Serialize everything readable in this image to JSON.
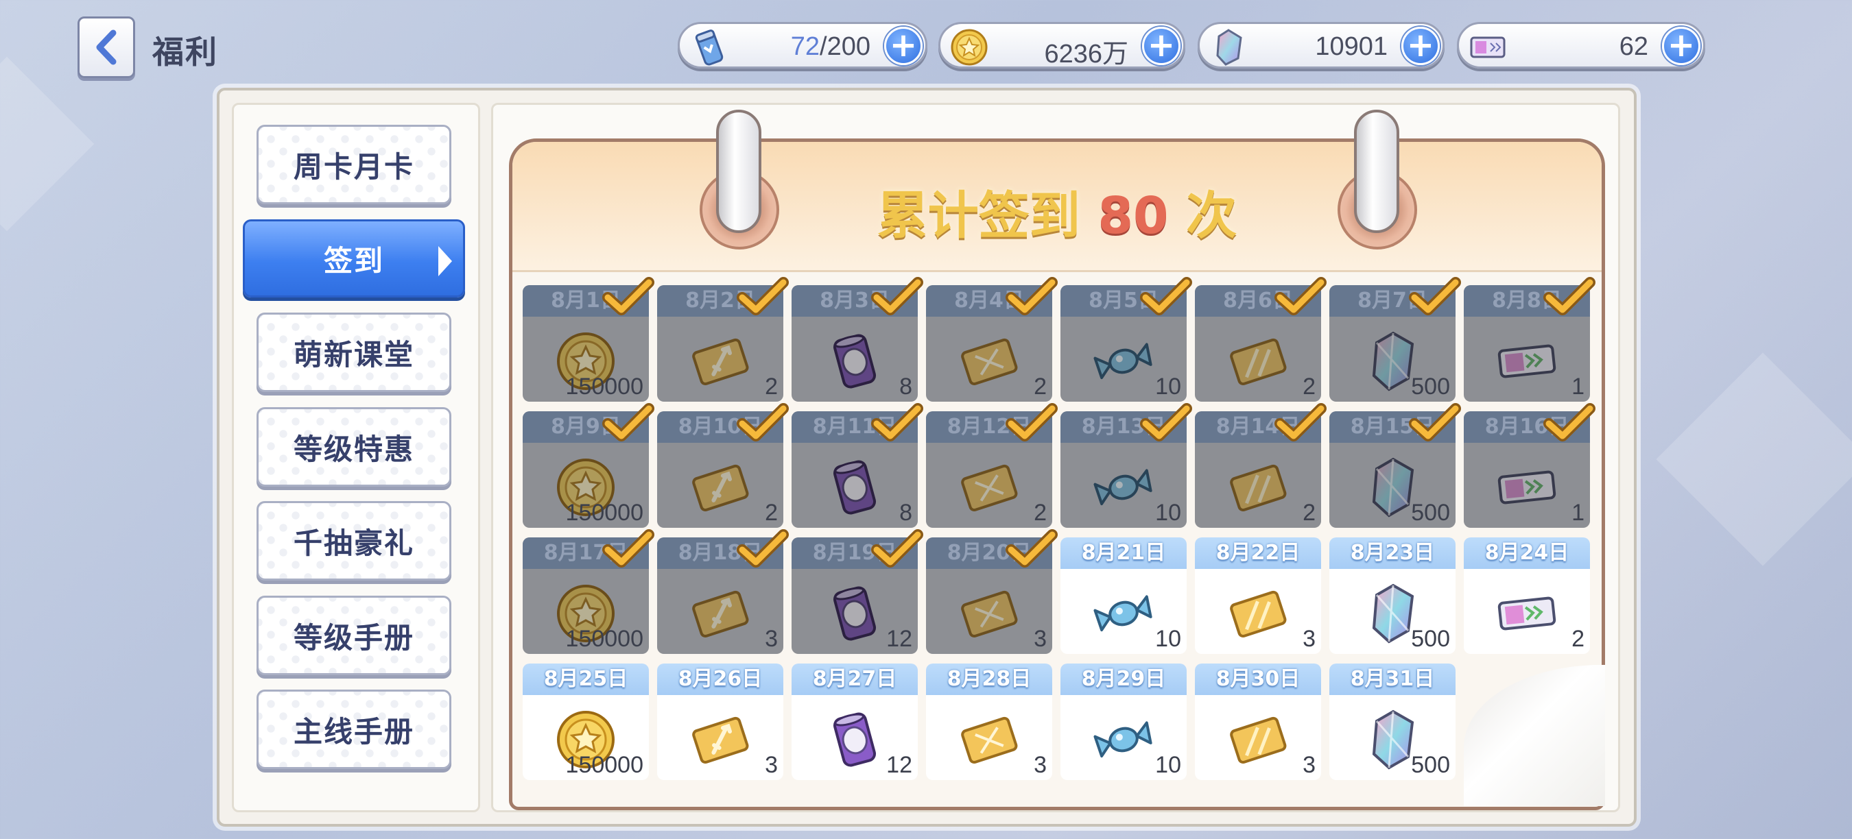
{
  "header": {
    "title": "福利",
    "resources": [
      {
        "icon": "stamina-potion-icon",
        "current": "72",
        "max": "/200"
      },
      {
        "icon": "gold-coin-icon",
        "value": "6236万"
      },
      {
        "icon": "crystal-gem-icon",
        "value": "10901"
      },
      {
        "icon": "ticket-icon",
        "value": "62"
      }
    ]
  },
  "sidebar": {
    "items": [
      {
        "label": "周卡月卡"
      },
      {
        "label": "签到"
      },
      {
        "label": "萌新课堂"
      },
      {
        "label": "等级特惠"
      },
      {
        "label": "千抽豪礼"
      },
      {
        "label": "等级手册"
      },
      {
        "label": "主线手册"
      }
    ],
    "active_index": 1
  },
  "calendar": {
    "title_prefix": "累计签到",
    "count": "80",
    "title_suffix": "次",
    "days": [
      {
        "date": "8月1日",
        "item": "coin",
        "qty": "150000",
        "claimed": true
      },
      {
        "date": "8月2日",
        "item": "gold-card-sword",
        "qty": "2",
        "claimed": true
      },
      {
        "date": "8月3日",
        "item": "potion-can",
        "qty": "8",
        "claimed": true
      },
      {
        "date": "8月4日",
        "item": "gold-card-dna",
        "qty": "2",
        "claimed": true
      },
      {
        "date": "8月5日",
        "item": "candy",
        "qty": "10",
        "claimed": true
      },
      {
        "date": "8月6日",
        "item": "gold-card-plain",
        "qty": "2",
        "claimed": true
      },
      {
        "date": "8月7日",
        "item": "crystal",
        "qty": "500",
        "claimed": true
      },
      {
        "date": "8月8日",
        "item": "ticket",
        "qty": "1",
        "claimed": true
      },
      {
        "date": "8月9日",
        "item": "coin",
        "qty": "150000",
        "claimed": true
      },
      {
        "date": "8月10日",
        "item": "gold-card-sword",
        "qty": "2",
        "claimed": true
      },
      {
        "date": "8月11日",
        "item": "potion-can",
        "qty": "8",
        "claimed": true
      },
      {
        "date": "8月12日",
        "item": "gold-card-dna",
        "qty": "2",
        "claimed": true
      },
      {
        "date": "8月13日",
        "item": "candy",
        "qty": "10",
        "claimed": true
      },
      {
        "date": "8月14日",
        "item": "gold-card-plain",
        "qty": "2",
        "claimed": true
      },
      {
        "date": "8月15日",
        "item": "crystal",
        "qty": "500",
        "claimed": true
      },
      {
        "date": "8月16日",
        "item": "ticket",
        "qty": "1",
        "claimed": true
      },
      {
        "date": "8月17日",
        "item": "coin",
        "qty": "150000",
        "claimed": true
      },
      {
        "date": "8月18日",
        "item": "gold-card-sword",
        "qty": "3",
        "claimed": true
      },
      {
        "date": "8月19日",
        "item": "potion-can",
        "qty": "12",
        "claimed": true
      },
      {
        "date": "8月20日",
        "item": "gold-card-dna",
        "qty": "3",
        "claimed": true
      },
      {
        "date": "8月21日",
        "item": "candy",
        "qty": "10",
        "claimed": false
      },
      {
        "date": "8月22日",
        "item": "gold-card-plain",
        "qty": "3",
        "claimed": false
      },
      {
        "date": "8月23日",
        "item": "crystal",
        "qty": "500",
        "claimed": false
      },
      {
        "date": "8月24日",
        "item": "ticket",
        "qty": "2",
        "claimed": false
      },
      {
        "date": "8月25日",
        "item": "coin",
        "qty": "150000",
        "claimed": false
      },
      {
        "date": "8月26日",
        "item": "gold-card-sword",
        "qty": "3",
        "claimed": false
      },
      {
        "date": "8月27日",
        "item": "potion-can",
        "qty": "12",
        "claimed": false
      },
      {
        "date": "8月28日",
        "item": "gold-card-dna",
        "qty": "3",
        "claimed": false
      },
      {
        "date": "8月29日",
        "item": "candy",
        "qty": "10",
        "claimed": false
      },
      {
        "date": "8月30日",
        "item": "gold-card-plain",
        "qty": "3",
        "claimed": false
      },
      {
        "date": "8月31日",
        "item": "crystal",
        "qty": "500",
        "claimed": false
      }
    ]
  }
}
